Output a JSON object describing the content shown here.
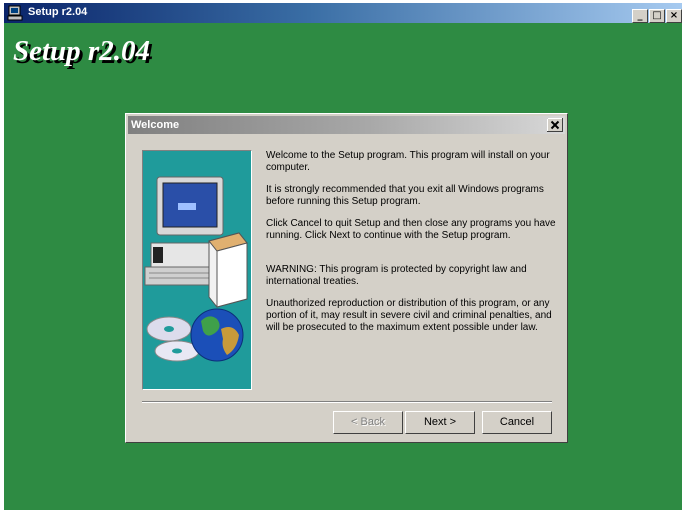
{
  "window": {
    "title": "Setup r2.04",
    "controls": [
      "minimize-icon",
      "maximize-icon",
      "close-icon"
    ],
    "background_color": "#2e8b43"
  },
  "banner": {
    "title": "Setup r2.04"
  },
  "dialog": {
    "title": "Welcome",
    "messages": [
      "Welcome to the  Setup program.  This program will install  on your computer.",
      "It is strongly recommended that you exit all Windows programs before running this Setup program.",
      "Click Cancel to quit Setup and then close any programs you have running.  Click Next to continue with the Setup program.",
      "WARNING: This program is protected by copyright law and international treaties.",
      "Unauthorized reproduction or distribution of this program, or any portion of it, may result in severe civil and criminal penalties, and will be prosecuted to the maximum extent possible under law."
    ],
    "buttons": {
      "back": "< Back",
      "next": "Next >",
      "cancel": "Cancel"
    },
    "back_enabled": false,
    "art_icons": [
      "computer-icon",
      "software-box-icon",
      "cd-icon",
      "globe-icon"
    ]
  }
}
